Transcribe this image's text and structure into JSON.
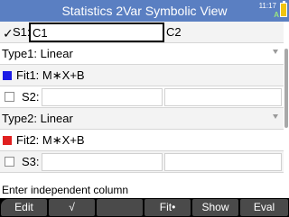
{
  "titlebar": {
    "title": "Statistics 2Var Symbolic View",
    "clock": "11:17",
    "mode_indicator": "A"
  },
  "rows": {
    "s1": {
      "check": "✓",
      "label": "S1:",
      "independent": "C1",
      "dependent": "C2"
    },
    "type1": {
      "label": "Type1:",
      "value": "Linear"
    },
    "fit1": {
      "label": "Fit1:",
      "value": "M∗X+B",
      "color": "#1a1ae6"
    },
    "s2": {
      "label": "S2:"
    },
    "type2": {
      "label": "Type2:",
      "value": "Linear"
    },
    "fit2": {
      "label": "Fit2:",
      "value": "M∗X+B",
      "color": "#e02020"
    },
    "s3": {
      "label": "S3:"
    }
  },
  "status": {
    "text": "Enter independent column"
  },
  "softkeys": [
    "Edit",
    "√",
    "",
    "Fit•",
    "Show",
    "Eval"
  ]
}
